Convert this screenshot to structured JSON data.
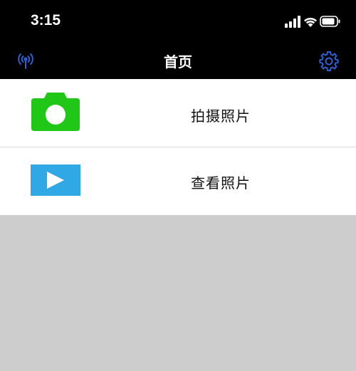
{
  "status": {
    "time": "3:15",
    "icons": [
      "signal-icon",
      "wifi-icon",
      "battery-icon"
    ]
  },
  "nav": {
    "title": "首页",
    "left_icon": "antenna-icon",
    "right_icon": "gear-icon",
    "accent": "#2f5fd6"
  },
  "menu": {
    "items": [
      {
        "label": "拍摄照片",
        "icon": "camera-icon",
        "icon_color": "#21c717"
      },
      {
        "label": "查看照片",
        "icon": "play-icon",
        "icon_color": "#31a8e6"
      }
    ]
  },
  "colors": {
    "background": "#cdcdcd",
    "bar": "#000000"
  }
}
